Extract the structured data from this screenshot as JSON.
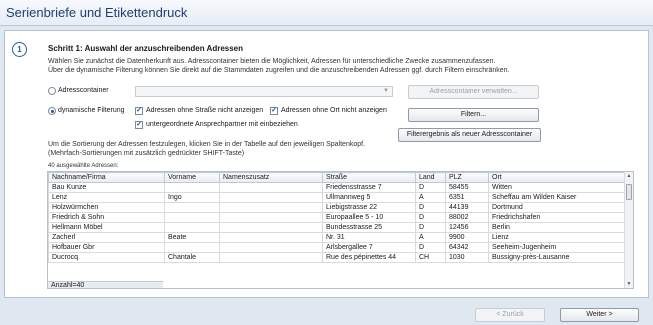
{
  "window": {
    "title": "Serienbriefe und Etikettendruck"
  },
  "step": {
    "number": "1",
    "title": "Schritt 1: Auswahl der anzuschreibenden Adressen",
    "intro_line1": "Wählen Sie zunächst die Datenherkunft aus. Adresscontainer bieten die Möglichkeit, Adressen für unterschiedliche Zwecke zusammenzufassen.",
    "intro_line2": "Über die dynamische Filterung können Sie direkt auf die Stammdaten zugreifen und die anzuschreibenden Adressen ggf. durch Filtern einschränken."
  },
  "source": {
    "container_label": "Adresscontainer",
    "container_selected": false,
    "container_dropdown_value": "",
    "manage_button": "Adresscontainer verwalten...",
    "dynamic_label": "dynamische Filterung",
    "dynamic_selected": true
  },
  "filters": {
    "no_street_label": "Adressen ohne Straße nicht anzeigen",
    "no_street_checked": true,
    "no_city_label": "Adressen ohne Ort nicht anzeigen",
    "no_city_checked": true,
    "sub_contacts_label": "untergeordnete Ansprechpartner mit einbeziehen",
    "sub_contacts_checked": true,
    "filter_button": "Filtern...",
    "save_result_button": "Filterergebnis als neuer Adresscontainer"
  },
  "sort_hint": {
    "line1": "Um die Sortierung der Adressen festzulegen, klicken Sie in der Tabelle auf den jeweiligen Spaltenkopf.",
    "line2": "(Mehrfach-Sortierungen mit zusätzlich gedrückter SHIFT-Taste)"
  },
  "table": {
    "count_label": "40 ausgewählte Adressen:",
    "columns": [
      "Nachname/Firma",
      "Vorname",
      "Namenszusatz",
      "Straße",
      "Land",
      "PLZ",
      "Ort"
    ],
    "rows": [
      [
        "Bau Kunze",
        "",
        "",
        "Friedensstrasse 7",
        "D",
        "58455",
        "Witten"
      ],
      [
        "Lenz",
        "Ingo",
        "",
        "Ullmannweg 5",
        "A",
        "6351",
        "Scheffau am Wilden Kaiser"
      ],
      [
        "Holzwürmchen",
        "",
        "",
        "Liebigstrasse 22",
        "D",
        "44139",
        "Dortmund"
      ],
      [
        "Friedrich & Sohn",
        "",
        "",
        "Europaallee 5 - 10",
        "D",
        "88002",
        "Friedrichshafen"
      ],
      [
        "Hellmann Möbel",
        "",
        "",
        "Bundesstrasse 25",
        "D",
        "12456",
        "Berlin"
      ],
      [
        "Zacherl",
        "Beate",
        "",
        "Nr. 31",
        "A",
        "9900",
        "Lienz"
      ],
      [
        "Hofbauer Gbr",
        "",
        "",
        "Arlsbergallee 7",
        "D",
        "64342",
        "Seeheim-Jugenheim"
      ],
      [
        "Ducrocq",
        "Chantale",
        "",
        "Rue des pépinettes 44",
        "CH",
        "1030",
        "Bussigny-près-Lausanne"
      ]
    ],
    "footer": "Anzahl=40"
  },
  "nav": {
    "back_label": "< Zurück",
    "next_label": "Weiter >"
  },
  "colors": {
    "title_text": "#1f3f6e",
    "accent": "#2b5a9a",
    "background": "#dfe7f1"
  }
}
